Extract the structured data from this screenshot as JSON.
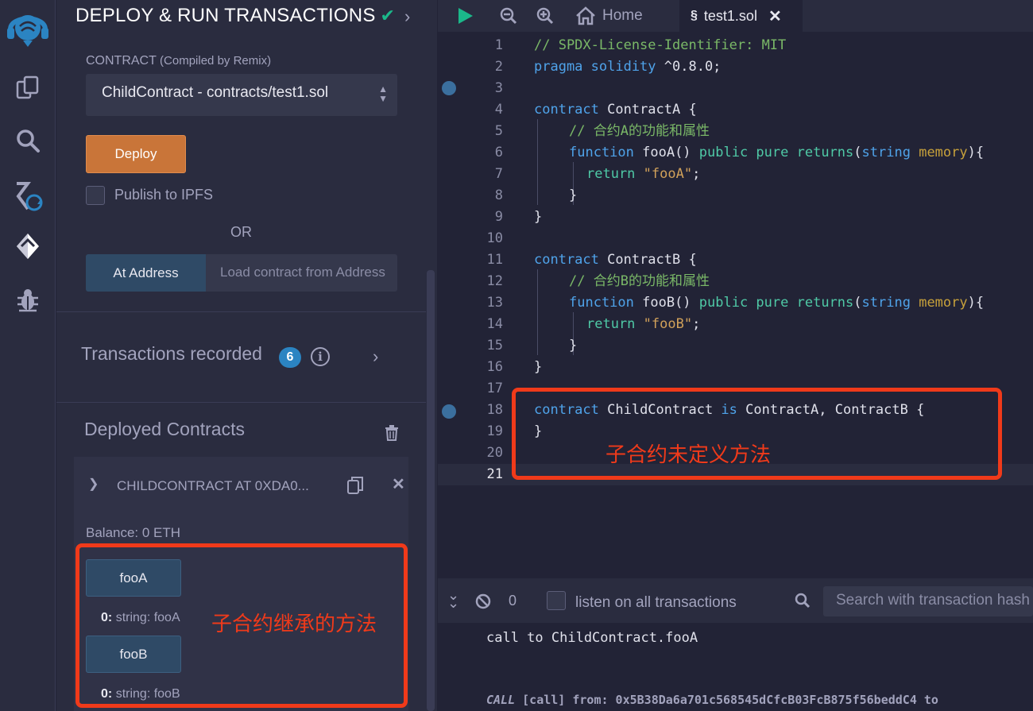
{
  "side_panel": {
    "title": "DEPLOY & RUN TRANSACTIONS",
    "contract_label": "CONTRACT",
    "contract_label_sub": "(Compiled by Remix)",
    "contract_selected": "ChildContract - contracts/test1.sol",
    "deploy_label": "Deploy",
    "publish_label": "Publish to IPFS",
    "or_label": "OR",
    "at_address_label": "At Address",
    "at_address_placeholder": "Load contract from Address",
    "transactions_label": "Transactions recorded",
    "transactions_count": "6",
    "deployed_label": "Deployed Contracts",
    "instance": {
      "title": "CHILDCONTRACT AT 0XDA0...",
      "balance": "Balance: 0 ETH",
      "functions": [
        {
          "name": "fooA",
          "output_index": "0:",
          "output": "string: fooA"
        },
        {
          "name": "fooB",
          "output_index": "0:",
          "output": "string: fooB"
        }
      ]
    },
    "annotation": "子合约继承的方法"
  },
  "editor": {
    "tabs": {
      "home": "Home",
      "file": "test1.sol"
    },
    "lines": [
      {
        "n": "1"
      },
      {
        "n": "2"
      },
      {
        "n": "3"
      },
      {
        "n": "4"
      },
      {
        "n": "5"
      },
      {
        "n": "6"
      },
      {
        "n": "7"
      },
      {
        "n": "8"
      },
      {
        "n": "9"
      },
      {
        "n": "10"
      },
      {
        "n": "11"
      },
      {
        "n": "12"
      },
      {
        "n": "13"
      },
      {
        "n": "14"
      },
      {
        "n": "15"
      },
      {
        "n": "16"
      },
      {
        "n": "17"
      },
      {
        "n": "18"
      },
      {
        "n": "19"
      },
      {
        "n": "20"
      },
      {
        "n": "21"
      }
    ],
    "code": {
      "l1": "// SPDX-License-Identifier: MIT",
      "l2_a": "pragma solidity",
      "l2_b": " ^0.8.0;",
      "l4_a": "contract",
      "l4_b": " ContractA {",
      "l5": "// 合约A的功能和属性",
      "l6_fn": "function",
      "l6_name": " fooA() ",
      "l6_pub": "public pure",
      "l6_ret": "returns",
      "l6_open": "(",
      "l6_str": "string",
      "l6_mem": "memory",
      "l6_close": "){",
      "l7_ret": "return",
      "l7_val": "\"fooA\"",
      "l7_end": ";",
      "l8": "}",
      "l9": "}",
      "l11_a": "contract",
      "l11_b": " ContractB {",
      "l12": "// 合约B的功能和属性",
      "l13_fn": "function",
      "l13_name": " fooB() ",
      "l13_pub": "public pure",
      "l13_ret": "returns",
      "l13_open": "(",
      "l13_str": "string",
      "l13_mem": "memory",
      "l13_close": "){",
      "l14_ret": "return",
      "l14_val": "\"fooB\"",
      "l14_end": ";",
      "l15": "}",
      "l16": "}",
      "l18_a": "contract",
      "l18_b": " ChildContract ",
      "l18_is": "is",
      "l18_c": " ContractA, ContractB {",
      "l19": "}"
    },
    "annotation": "子合约未定义方法"
  },
  "terminal": {
    "count": "0",
    "listen_label": "listen on all transactions",
    "search_placeholder": "Search with transaction hash or address",
    "line1": "call to ChildContract.fooA",
    "line2_call": "CALL",
    "line2_rest": "[call]  from: 0x5B38Da6a701c568545dCfcB03FcB875f56beddC4 to"
  },
  "colors": {
    "accent_deploy": "#c97539",
    "badge": "#2b84c2",
    "annotation_red": "#f03a1a",
    "success_check": "#1bb88a"
  }
}
